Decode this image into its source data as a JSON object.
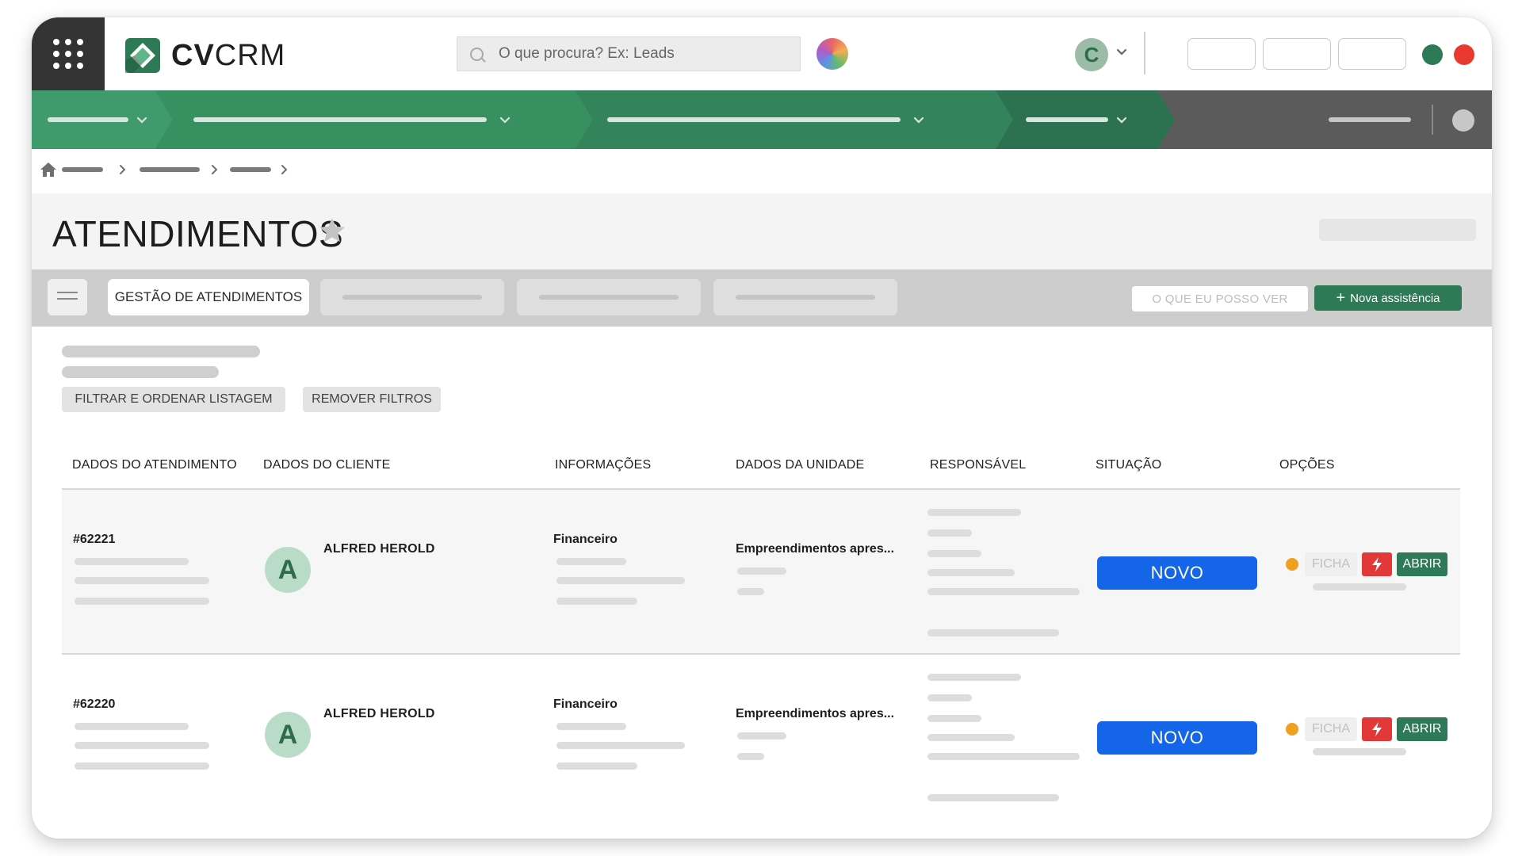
{
  "app": {
    "brand_bold": "CV",
    "brand_light": "CRM",
    "search": {
      "placeholder": "O que procura? Ex: Leads"
    },
    "user_initial": "C"
  },
  "page": {
    "title": "ATENDIMENTOS"
  },
  "tabs": {
    "active_label": "GESTÃO DE ATENDIMENTOS",
    "see_label": "O QUE EU POSSO VER",
    "new_label": "Nova assistência"
  },
  "filters": {
    "filter_label": "FILTRAR E ORDENAR LISTAGEM",
    "remove_label": "REMOVER FILTROS"
  },
  "table": {
    "headers": [
      "DADOS DO ATENDIMENTO",
      "DADOS DO CLIENTE",
      "INFORMAÇÕES",
      "DADOS DA UNIDADE",
      "RESPONSÁVEL",
      "SITUAÇÃO",
      "OPÇÕES"
    ],
    "rows": [
      {
        "id": "#62221",
        "client_initial": "A",
        "client_name": "ALFRED HEROLD",
        "info": "Financeiro",
        "unit": "Empreendimentos apres...",
        "status": "NOVO",
        "ficha": "FICHA",
        "abrir": "ABRIR"
      },
      {
        "id": "#62220",
        "client_initial": "A",
        "client_name": "ALFRED HEROLD",
        "info": "Financeiro",
        "unit": "Empreendimentos apres...",
        "status": "NOVO",
        "ficha": "FICHA",
        "abrir": "ABRIR"
      }
    ]
  },
  "colors": {
    "brand_green": "#2e7a56",
    "nav_green_light": "#3f9a6c",
    "nav_green_dark": "#2d7250",
    "status_blue": "#1565e8",
    "danger_red": "#e33838",
    "pending_orange": "#f0a020",
    "online_green": "#2e7a56",
    "offline_red": "#e83a2e"
  },
  "icons": [
    "app-grid-icon",
    "search-icon",
    "globe-icon",
    "chevron-down-icon",
    "home-icon",
    "chevron-right-icon",
    "star-icon",
    "menu-icon",
    "plus-icon",
    "bolt-icon"
  ]
}
